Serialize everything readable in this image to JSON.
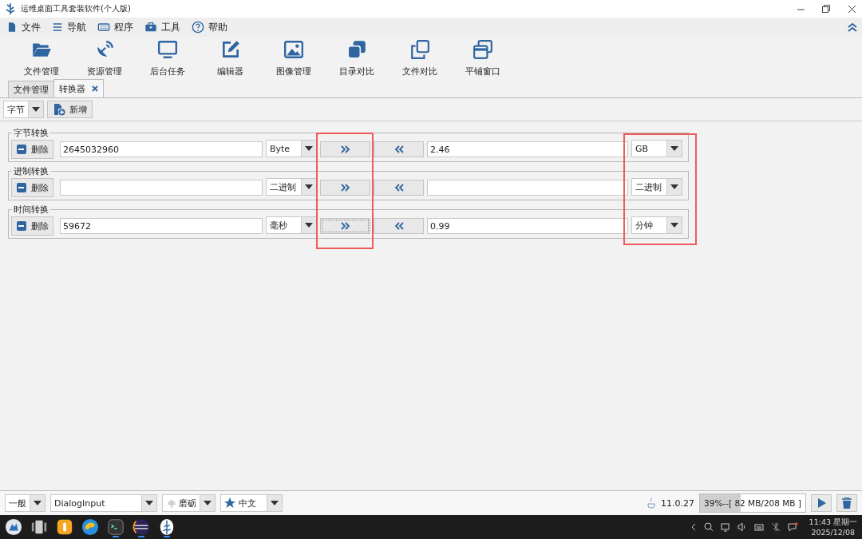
{
  "window": {
    "title": "运维桌面工具套装软件(个人版)"
  },
  "menu": [
    {
      "label": "文件",
      "kind": "file"
    },
    {
      "label": "导航",
      "kind": "lines"
    },
    {
      "label": "程序",
      "kind": "keyboard"
    },
    {
      "label": "工具",
      "kind": "toolbox"
    },
    {
      "label": "帮助",
      "kind": "help"
    }
  ],
  "toolbar": [
    {
      "label": "文件管理",
      "kind": "folder"
    },
    {
      "label": "资源管理",
      "kind": "dish"
    },
    {
      "label": "后台任务",
      "kind": "monitor"
    },
    {
      "label": "编辑器",
      "kind": "edit"
    },
    {
      "label": "图像管理",
      "kind": "image"
    },
    {
      "label": "目录对比",
      "kind": "copy-filled"
    },
    {
      "label": "文件对比",
      "kind": "copy"
    },
    {
      "label": "平铺窗口",
      "kind": "windows"
    }
  ],
  "tabs": [
    {
      "label": "文件管理",
      "selected": false,
      "closable": false
    },
    {
      "label": "转换器",
      "selected": true,
      "closable": true
    }
  ],
  "converter": {
    "type": "字节",
    "add_button": "新增"
  },
  "groups": [
    {
      "title": "字节转换",
      "delete": "删除",
      "left_value": "2645032960",
      "left_unit": "Byte",
      "right_value": "2.46",
      "right_unit": "GB",
      "forward_focused": false
    },
    {
      "title": "进制转换",
      "delete": "删除",
      "left_unit": "二进制",
      "right_unit": "二进制",
      "forward_focused": false
    },
    {
      "title": "时间转换",
      "delete": "删除",
      "left_value": "59672",
      "left_unit": "毫秒",
      "right_value": "0.99",
      "right_unit": "分钟",
      "forward_focused": true
    }
  ],
  "status_bar": {
    "mode": "一般",
    "font": "DialogInput",
    "theme": "磨砺",
    "language": "中文",
    "java_version": "11.0.27",
    "memory": {
      "text": "39%--[ 82 MB/208 MB ]",
      "level": 0.39
    }
  },
  "taskbar": {
    "apps": [
      {
        "kind": "launcher",
        "running": false
      },
      {
        "kind": "multitask",
        "running": false
      },
      {
        "kind": "orange",
        "running": false
      },
      {
        "kind": "browser",
        "running": false
      },
      {
        "kind": "terminal",
        "running": true
      },
      {
        "kind": "eclipse",
        "running": true
      },
      {
        "kind": "tree",
        "running": true
      }
    ],
    "time": "11:43 星期一",
    "date": "2025/12/08"
  }
}
